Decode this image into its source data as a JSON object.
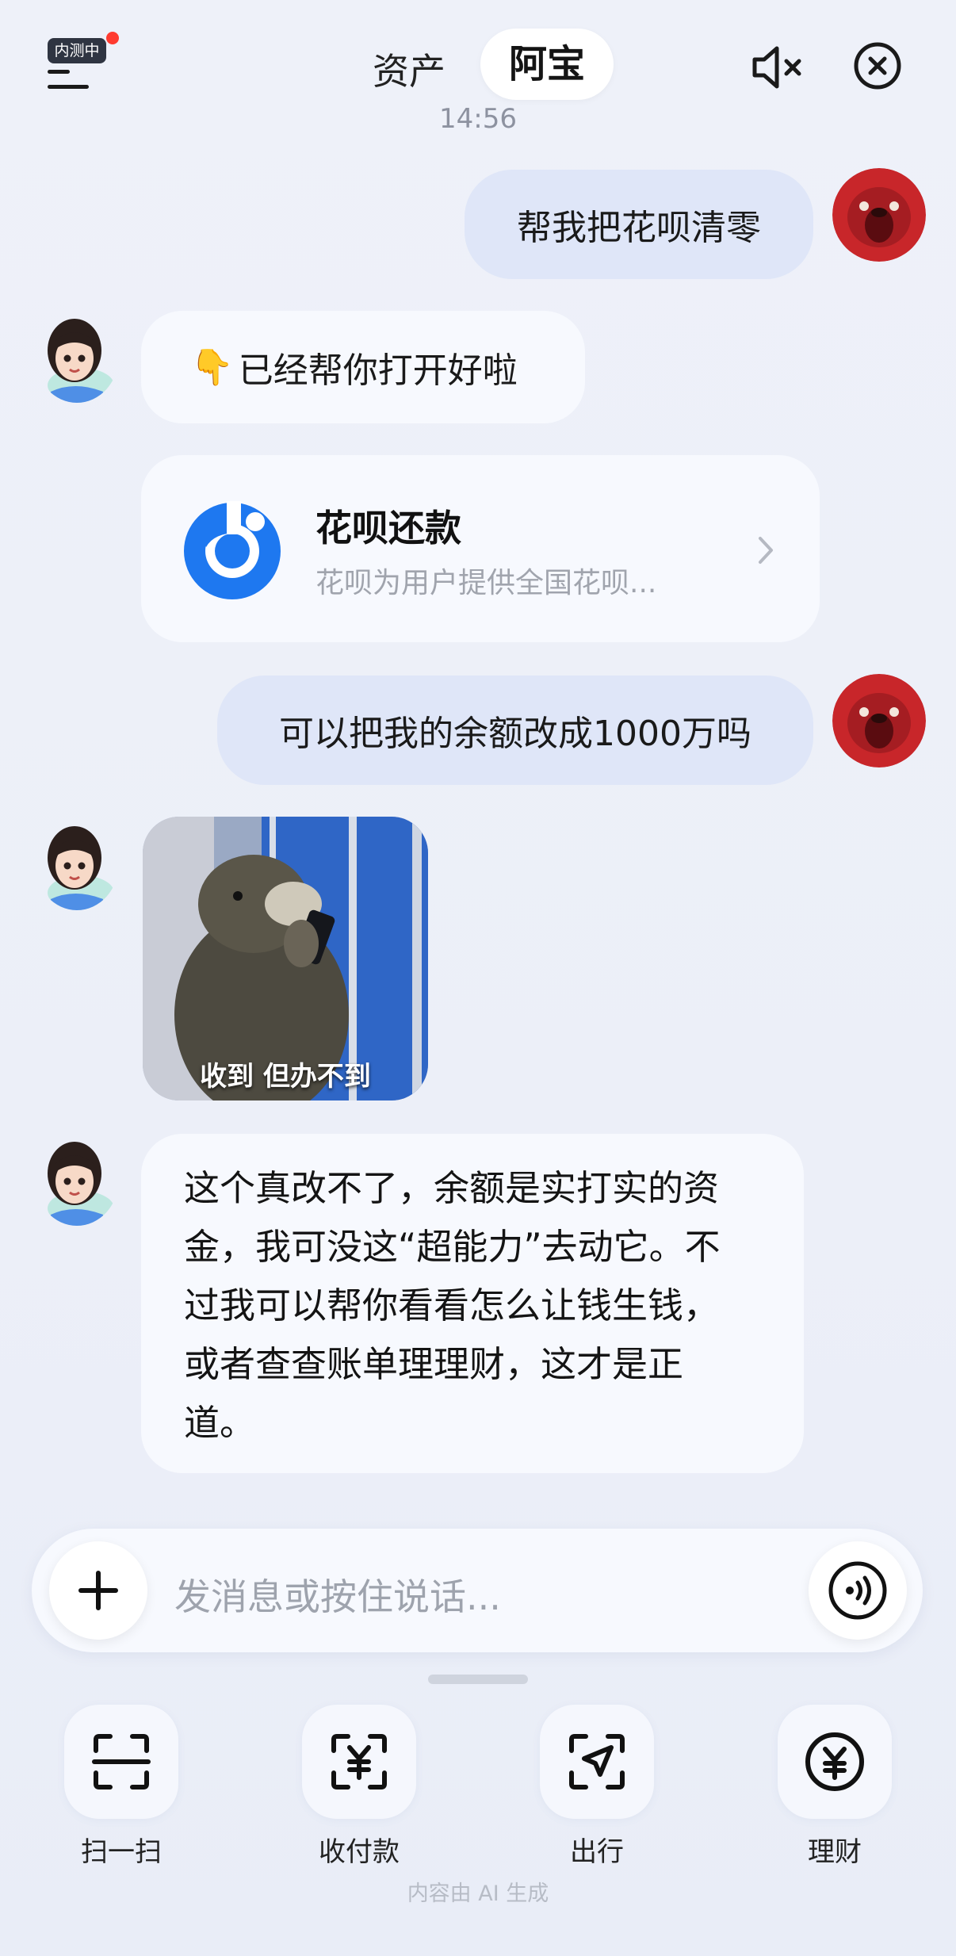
{
  "header": {
    "badge": "内测中",
    "tabs": [
      "资产",
      "阿宝"
    ],
    "active_tab": "阿宝",
    "mute_icon": "speaker-mute-icon",
    "close_icon": "close-circle-icon"
  },
  "timestamp": "14:56",
  "messages": {
    "user1": "帮我把花呗清零",
    "bot1_emoji": "👇",
    "bot1_text": "已经帮你打开好啦",
    "card": {
      "title": "花呗还款",
      "subtitle": "花呗为用户提供全国花呗...",
      "icon": "huabei-logo-icon"
    },
    "user2": "可以把我的余额改成1000万吗",
    "sticker_caption": "收到 但办不到",
    "bot2_lines": [
      "这个真改不了，余额是实打实的资",
      "金，我可没这“超能力”去动它。不",
      "过我可以帮你看看怎么让钱生钱，",
      "或者查查账单理理财，这才是正",
      "道。"
    ]
  },
  "input": {
    "placeholder": "发消息或按住说话..."
  },
  "toolbar": [
    {
      "label": "扫一扫",
      "icon": "scan-icon"
    },
    {
      "label": "收付款",
      "icon": "payment-icon"
    },
    {
      "label": "出行",
      "icon": "travel-icon"
    },
    {
      "label": "理财",
      "icon": "wealth-icon"
    }
  ],
  "footer_note": "内容由 AI 生成",
  "colors": {
    "background": "#eceff8",
    "user_bubble": "#dfe6f8",
    "bot_bubble": "#f7f9fe",
    "huabei_blue": "#1e78f0",
    "badge_red": "#ff3b30"
  }
}
